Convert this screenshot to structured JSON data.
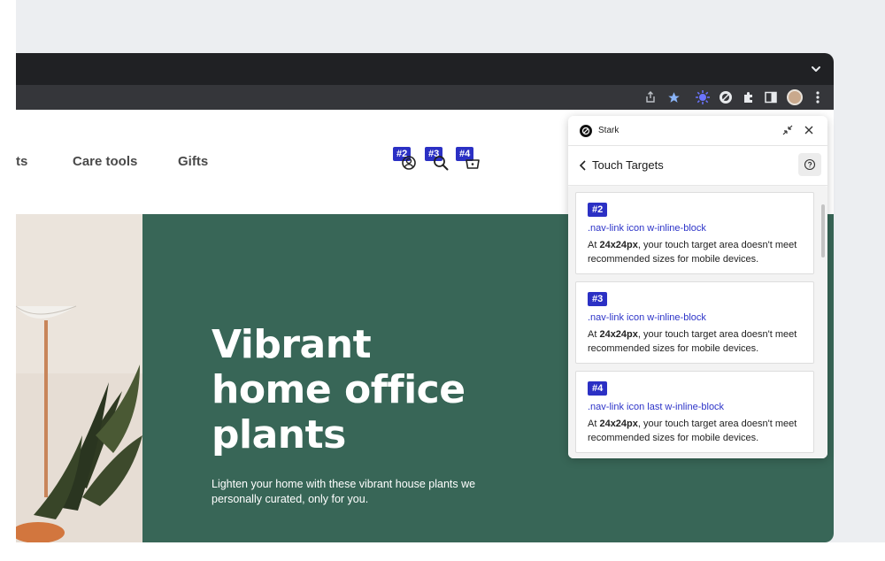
{
  "website": {
    "nav_items": [
      "ts",
      "Care tools",
      "Gifts"
    ],
    "badges": [
      "#2",
      "#3",
      "#4"
    ],
    "icons": [
      "user-icon",
      "search-icon",
      "basket-icon"
    ],
    "hero": {
      "title_lines": [
        "Vibrant",
        "home office",
        "plants"
      ],
      "subtitle_lines": [
        "Lighten your home with these vibrant house plants we",
        "personally curated, only for you."
      ]
    },
    "colors": {
      "hero_bg": "#386657",
      "badge": "#2b30c4"
    }
  },
  "stark": {
    "app_name": "Stark",
    "panel_title": "Touch Targets",
    "issues": [
      {
        "badge": "#2",
        "selector": ".nav-link icon w-inline-block",
        "desc_prefix": "At ",
        "desc_size": "24x24px",
        "desc_suffix": ", your touch target area doesn't meet recommended sizes for mobile devices."
      },
      {
        "badge": "#3",
        "selector": ".nav-link icon w-inline-block",
        "desc_prefix": "At ",
        "desc_size": "24x24px",
        "desc_suffix": ", your touch target area doesn't meet recommended sizes for mobile devices."
      },
      {
        "badge": "#4",
        "selector": ".nav-link icon last w-inline-block",
        "desc_prefix": "At ",
        "desc_size": "24x24px",
        "desc_suffix": ", your touch target area doesn't meet recommended sizes for mobile devices."
      }
    ]
  }
}
